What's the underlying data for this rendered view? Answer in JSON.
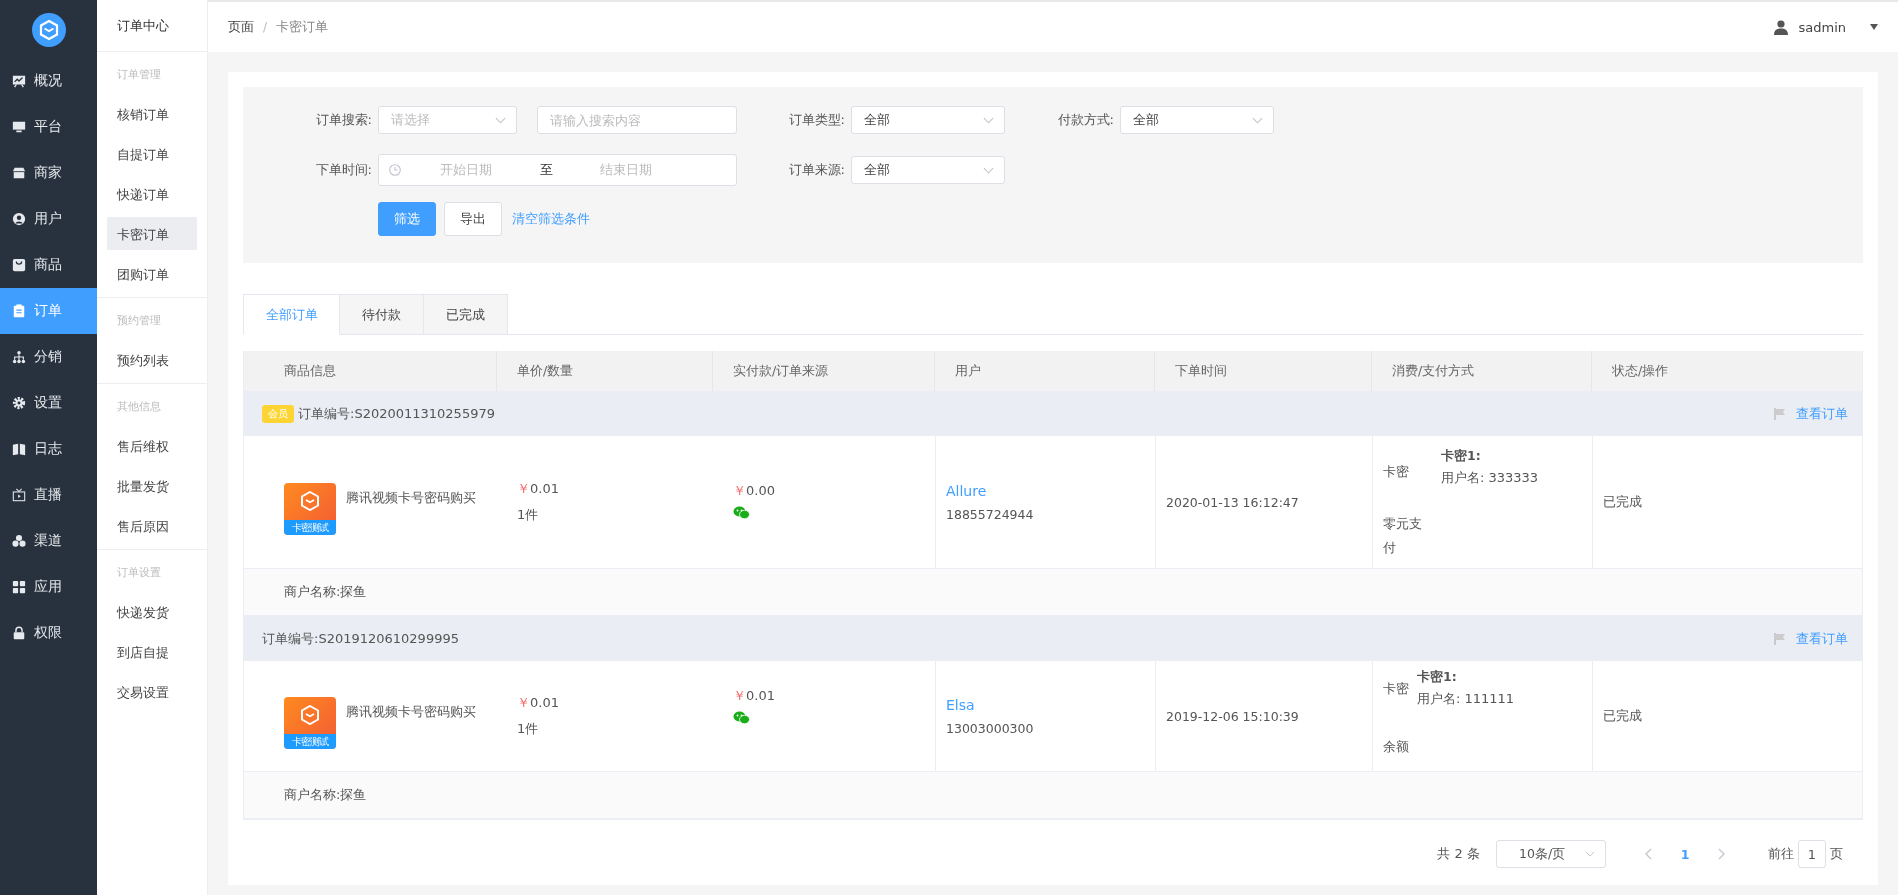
{
  "sidebar": {
    "items": [
      {
        "label": "概况",
        "selected": false
      },
      {
        "label": "平台",
        "selected": false
      },
      {
        "label": "商家",
        "selected": false
      },
      {
        "label": "用户",
        "selected": false
      },
      {
        "label": "商品",
        "selected": false
      },
      {
        "label": "订单",
        "selected": true
      },
      {
        "label": "分销",
        "selected": false
      },
      {
        "label": "设置",
        "selected": false
      },
      {
        "label": "日志",
        "selected": false
      },
      {
        "label": "直播",
        "selected": false
      },
      {
        "label": "渠道",
        "selected": false
      },
      {
        "label": "应用",
        "selected": false
      },
      {
        "label": "权限",
        "selected": false
      }
    ]
  },
  "subnav": {
    "title": "订单中心",
    "groups": [
      {
        "heading": "订单管理",
        "items": [
          {
            "label": "核销订单",
            "selected": false
          },
          {
            "label": "自提订单",
            "selected": false
          },
          {
            "label": "快递订单",
            "selected": false
          },
          {
            "label": "卡密订单",
            "selected": true
          },
          {
            "label": "团购订单",
            "selected": false
          }
        ]
      },
      {
        "heading": "预约管理",
        "items": [
          {
            "label": "预约列表",
            "selected": false
          }
        ]
      },
      {
        "heading": "其他信息",
        "items": [
          {
            "label": "售后维权",
            "selected": false
          },
          {
            "label": "批量发货",
            "selected": false
          },
          {
            "label": "售后原因",
            "selected": false
          }
        ]
      },
      {
        "heading": "订单设置",
        "items": [
          {
            "label": "快递发货",
            "selected": false
          },
          {
            "label": "到店自提",
            "selected": false
          },
          {
            "label": "交易设置",
            "selected": false
          }
        ]
      }
    ]
  },
  "header": {
    "breadcrumb": [
      "页面",
      "卡密订单"
    ],
    "breadcrumb_separator": "/",
    "user": "sadmin"
  },
  "filters": {
    "search_label": "订单搜索:",
    "search_select": {
      "placeholder": "请选择"
    },
    "search_input": {
      "placeholder": "请输入搜索内容"
    },
    "type_label": "订单类型:",
    "type_value": "全部",
    "pay_label": "付款方式:",
    "pay_value": "全部",
    "time_label": "下单时间:",
    "start_placeholder": "开始日期",
    "range_separator": "至",
    "end_placeholder": "结束日期",
    "source_label": "订单来源:",
    "source_value": "全部",
    "buttons": [
      {
        "label": "筛选",
        "kind": "primary"
      },
      {
        "label": "导出",
        "kind": "default"
      },
      {
        "label": "清空筛选条件",
        "kind": "link"
      }
    ]
  },
  "tabs": [
    {
      "label": "全部订单",
      "selected": true
    },
    {
      "label": "待付款",
      "selected": false
    },
    {
      "label": "已完成",
      "selected": false
    }
  ],
  "table": {
    "columns": [
      "商品信息",
      "单价/数量",
      "实付款/订单来源",
      "用户",
      "下单时间",
      "消费/支付方式",
      "状态/操作"
    ],
    "orders": [
      {
        "badge": "会员",
        "order_no": "订单编号:S2020011310255979",
        "action": "查看订单",
        "thumb_caption": "卡密测试",
        "product": "腾讯视频卡号密码购买",
        "currency": "￥",
        "price": "0.01",
        "quantity": "1件",
        "paid_currency": "￥",
        "paid": "0.00",
        "user": "Allure",
        "phone": "18855724944",
        "time": "2020-01-13 16:12:47",
        "consume": "卡密",
        "payment": "零元支付",
        "card_title": "卡密1:",
        "card_user": "用户名: 333333",
        "status": "已完成",
        "merchant": "商户名称:探鱼"
      },
      {
        "order_no": "订单编号:S2019120610299995",
        "action": "查看订单",
        "thumb_caption": "卡密测试",
        "product": "腾讯视频卡号密码购买",
        "currency": "￥",
        "price": "0.01",
        "quantity": "1件",
        "paid_currency": "￥",
        "paid": "0.01",
        "user": "Elsa",
        "phone": "13003000300",
        "time": "2019-12-06 15:10:39",
        "consume": "卡密",
        "payment": "余额",
        "card_title": "卡密1:",
        "card_user": "用户名: 111111",
        "status": "已完成",
        "merchant": "商户名称:探鱼"
      }
    ]
  },
  "pagination": {
    "total": "共 2 条",
    "page_size": "10条/页",
    "pages": [
      {
        "label": "1",
        "selected": true
      }
    ],
    "goto_label": "前往",
    "goto_value": "1",
    "goto_suffix": "页"
  }
}
